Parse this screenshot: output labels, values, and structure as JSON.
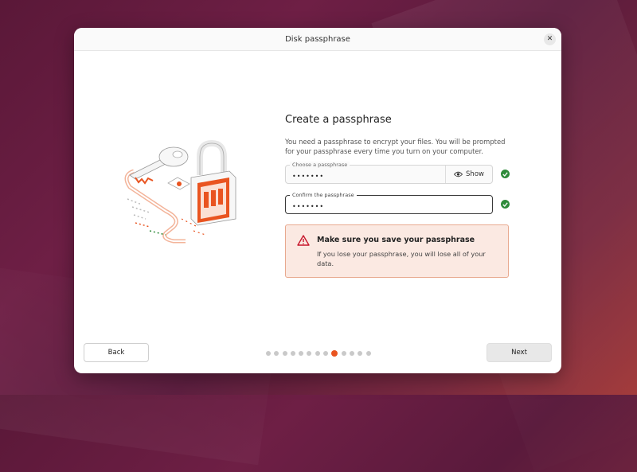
{
  "window": {
    "title": "Disk passphrase"
  },
  "content": {
    "heading": "Create a passphrase",
    "description": "You need a passphrase to encrypt your files. You will be prompted for your passphrase every time you turn on your computer."
  },
  "fields": {
    "choose": {
      "label": "Choose a passphrase",
      "value": "•••••••",
      "show_label": "Show"
    },
    "confirm": {
      "label": "Confirm the passphrase",
      "value": "•••••••"
    }
  },
  "warning": {
    "title": "Make sure you save your passphrase",
    "text": "If you lose your passphrase, you will lose all of your data."
  },
  "footer": {
    "back_label": "Back",
    "next_label": "Next",
    "steps_total": 13,
    "step_current": 9
  },
  "colors": {
    "accent": "#e95420",
    "success": "#2e8b3a",
    "warning_bg": "#fbe9e2",
    "warning_border": "#e8a98f"
  },
  "icons": [
    "close-icon",
    "eye-icon",
    "check-icon",
    "warning-triangle-icon"
  ]
}
